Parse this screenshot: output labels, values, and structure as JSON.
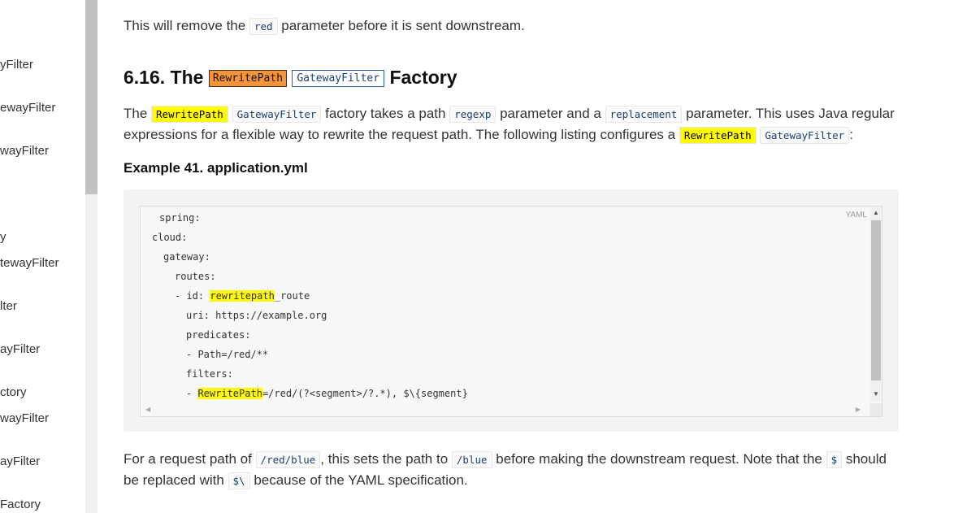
{
  "sidebar": {
    "items": [
      "yFilter",
      "ewayFilter",
      "wayFilter",
      "y",
      "tewayFilter",
      "lter",
      "ayFilter",
      "ctory",
      "wayFilter",
      "ayFilter",
      "Factory"
    ]
  },
  "intro": {
    "before": "This will remove the ",
    "code": "red",
    "after": " parameter before it is sent downstream."
  },
  "heading": {
    "number": "6.16. The",
    "code1": "RewritePath",
    "code2": "GatewayFilter",
    "suffix": "Factory"
  },
  "description": {
    "t1": "The ",
    "c1": "RewritePath",
    "c2": "GatewayFilter",
    "t2": " factory takes a path ",
    "c3": "regexp",
    "t3": " parameter and a ",
    "c4": "replacement",
    "t4": " parameter. This uses Java regular expressions for a flexible way to rewrite the request path. The following listing configures a ",
    "c5": "RewritePath",
    "c6": "GatewayFilter",
    "t5": ":"
  },
  "example_title": "Example 41. application.yml",
  "code": {
    "language": "YAML",
    "lines": [
      {
        "text": "spring:"
      },
      {
        "text": "cloud:"
      },
      {
        "text": "gateway:"
      },
      {
        "text": "routes:"
      },
      {
        "pre": "- id: ",
        "mark": "rewritepath",
        "post": "_route"
      },
      {
        "text": "uri: https://example.org"
      },
      {
        "text": "predicates:"
      },
      {
        "text": "- Path=/red/**"
      },
      {
        "text": "filters:"
      },
      {
        "pre": "- ",
        "mark": "RewritePath",
        "post": "=/red/(?<segment>/?.*), $\\{segment}"
      }
    ]
  },
  "footer": {
    "t1": "For a request path of ",
    "c1": "/red/blue",
    "t2": ", this sets the path to ",
    "c2": "/blue",
    "t3": " before making the downstream request. Note that the ",
    "c3": "$",
    "t4": " should be replaced with ",
    "c4": "$\\",
    "t5": " because of the YAML specification."
  }
}
